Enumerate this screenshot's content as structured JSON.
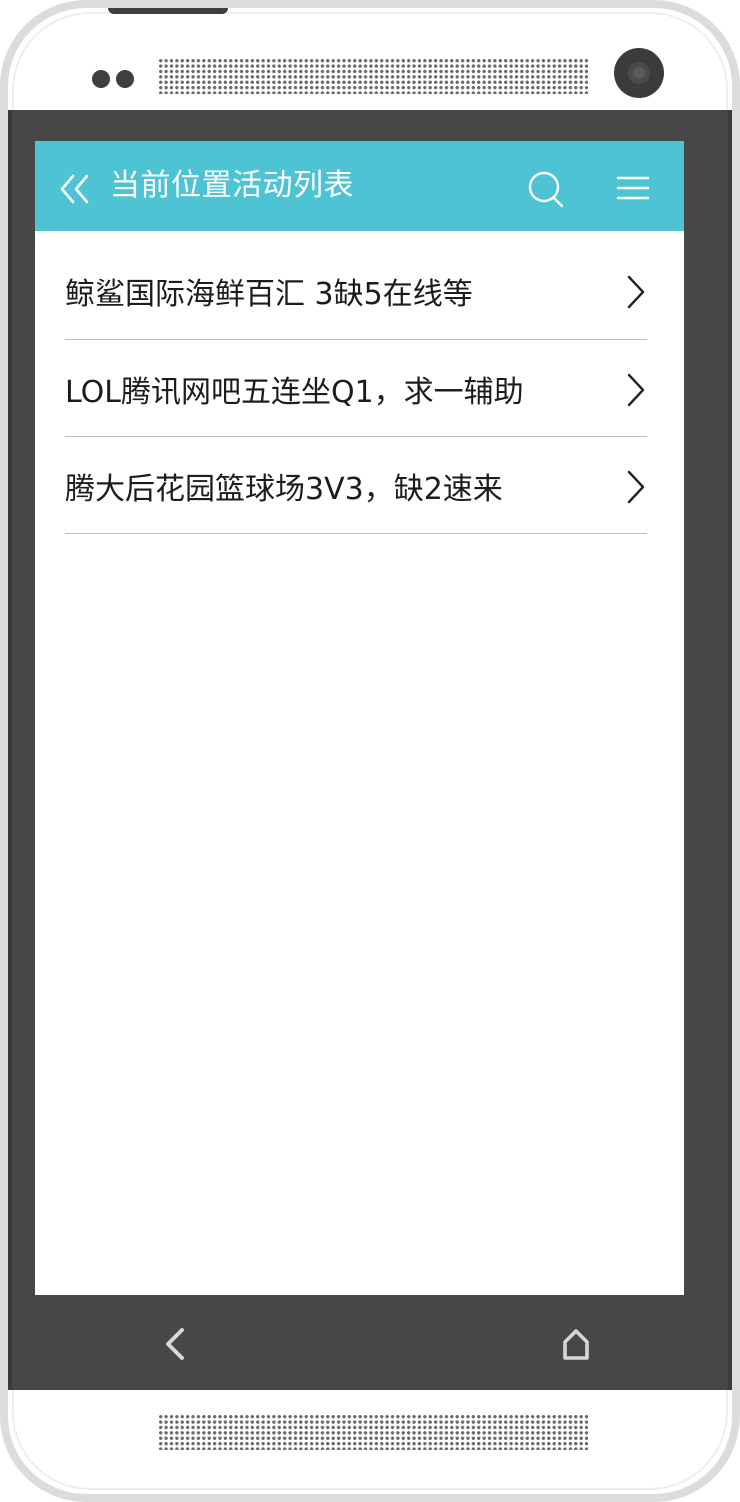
{
  "header": {
    "title": "当前位置活动列表",
    "back_icon": "double-chevron-left-icon",
    "search_icon": "search-icon",
    "menu_icon": "hamburger-menu-icon"
  },
  "activities": [
    {
      "title": "鲸鲨国际海鲜百汇 3缺5在线等"
    },
    {
      "title": "LOL腾讯网吧五连坐Q1，求一辅助"
    },
    {
      "title": "腾大后花园篮球场3V3，缺2速来"
    }
  ],
  "system_nav": {
    "back_icon": "back-icon",
    "home_icon": "home-icon"
  },
  "colors": {
    "header": "#4ec3d4",
    "device_body": "#474747",
    "text": "#1c1c1c",
    "divider": "#bdbdbd"
  }
}
